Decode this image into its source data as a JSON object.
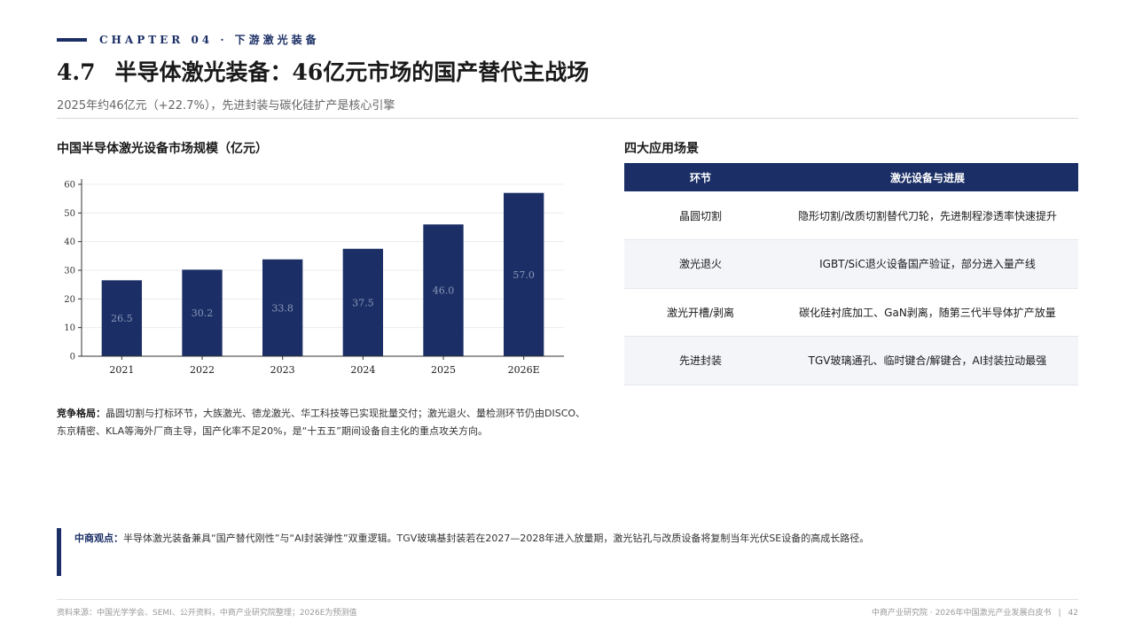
{
  "header": {
    "chapter": "CHAPTER 04 · 下游激光装备",
    "title_num": "4.7",
    "title_text": "半导体激光装备：46亿元市场的国产替代主战场",
    "subtitle": "2025年约46亿元（+22.7%），先进封装与碳化硅扩产是核心引擎"
  },
  "chart_section": {
    "title": "中国半导体激光设备市场规模（亿元）"
  },
  "chart_data": {
    "type": "bar",
    "categories": [
      "2021",
      "2022",
      "2023",
      "2024",
      "2025",
      "2026E"
    ],
    "values": [
      26.5,
      30.2,
      33.8,
      37.5,
      46.0,
      57.0
    ],
    "value_labels": [
      "26.5",
      "30.2",
      "33.8",
      "37.5",
      "46.0",
      "57.0"
    ],
    "title": "中国半导体激光设备市场规模（亿元）",
    "xlabel": "",
    "ylabel": "",
    "ylim": [
      0,
      60
    ],
    "yticks": [
      0,
      10,
      20,
      30,
      40,
      50,
      60
    ],
    "grid": true,
    "colors": {
      "bar": "#1b2f66",
      "label": "#8a96b8",
      "grid": "#ececec",
      "axis": "#333333"
    }
  },
  "competition": {
    "label": "竞争格局：",
    "text": "晶圆切割与打标环节，大族激光、德龙激光、华工科技等已实现批量交付；激光退火、量检测环节仍由DISCO、东京精密、KLA等海外厂商主导，国产化率不足20%，是“十五五”期间设备自主化的重点攻关方向。"
  },
  "table_section": {
    "title": "四大应用场景",
    "headers": [
      "环节",
      "激光设备与进展"
    ],
    "rows": [
      {
        "stage": "晶圆切割",
        "progress": "隐形切割/改质切割替代刀轮，先进制程渗透率快速提升"
      },
      {
        "stage": "激光退火",
        "progress": "IGBT/SiC退火设备国产验证，部分进入量产线"
      },
      {
        "stage": "激光开槽/剥离",
        "progress": "碳化硅衬底加工、GaN剥离，随第三代半导体扩产放量"
      },
      {
        "stage": "先进封装",
        "progress": "TGV玻璃通孔、临时键合/解键合，AI封装拉动最强"
      }
    ]
  },
  "viewpoint": {
    "label": "中商观点：",
    "text": "半导体激光装备兼具“国产替代刚性”与“AI封装弹性”双重逻辑。TGV玻璃基封装若在2027—2028年进入放量期，激光钻孔与改质设备将复制当年光伏SE设备的高成长路径。"
  },
  "footer": {
    "source": "资料来源：中国光学学会、SEMI、公开资料，中商产业研究院整理；2026E为预测值",
    "publisher": "中商产业研究院 · 2026年中国激光产业发展白皮书",
    "separator": "|",
    "page": "42"
  },
  "colors": {
    "brand": "#1b2f66"
  }
}
